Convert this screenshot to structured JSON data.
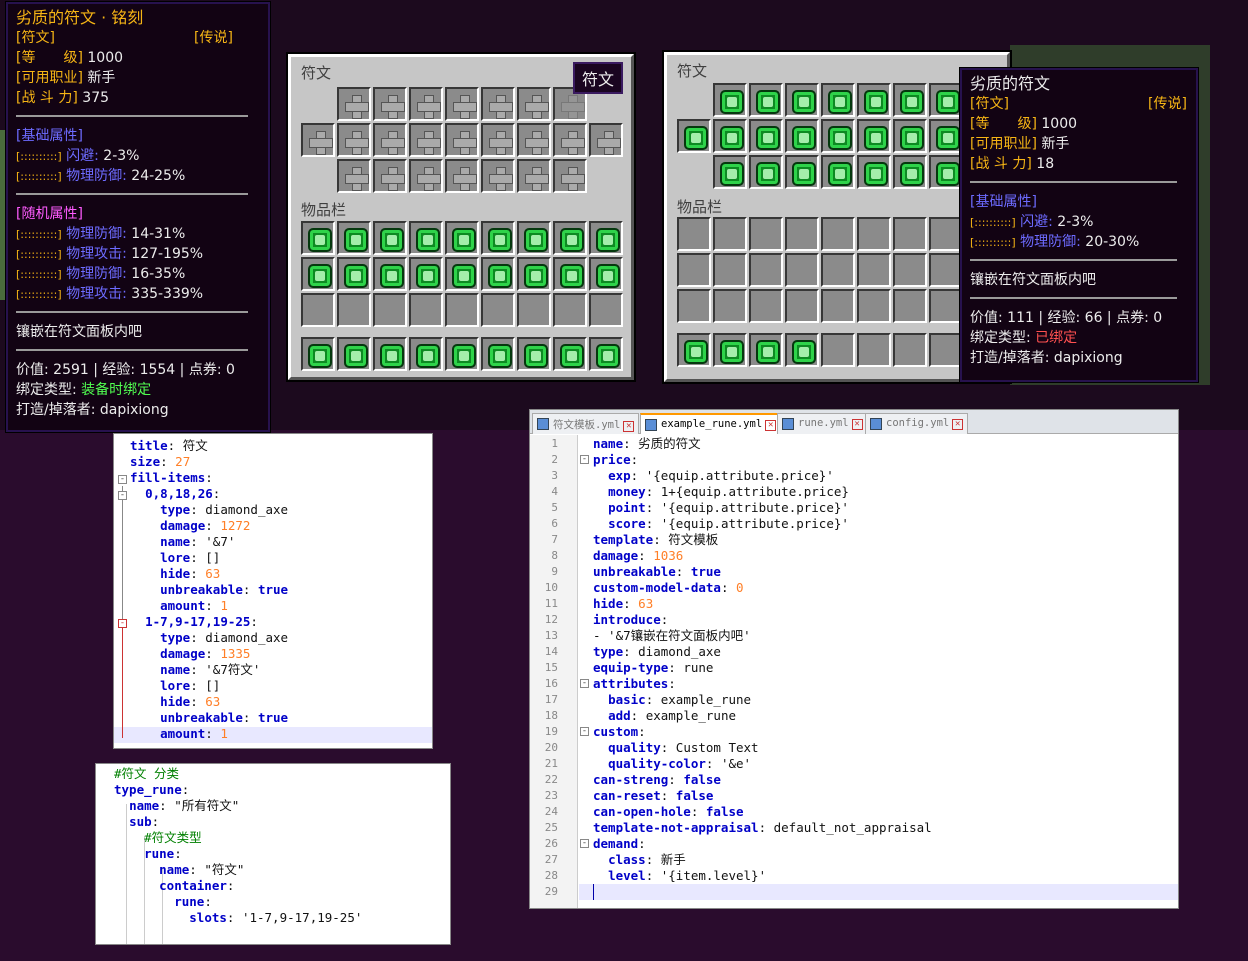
{
  "tooltip_left": {
    "title": "劣质的符文 · 铭刻",
    "type_tag": "[符文]",
    "rarity_tag": "[传说]",
    "level_label": "[等　　级]",
    "level_val": "1000",
    "job_label": "[可用职业]",
    "job_val": "新手",
    "power_label": "[战 斗 力]",
    "power_val": "375",
    "basic_header": "[基础属性]",
    "basic": [
      {
        "bar": "[::::::::::]",
        "name": "闪避:",
        "val": "2-3%"
      },
      {
        "bar": "[::::::::::]",
        "name": "物理防御:",
        "val": "24-25%"
      }
    ],
    "random_header": "[随机属性]",
    "random": [
      {
        "bar": "[::::::::::]",
        "name": "物理防御:",
        "val": "14-31%"
      },
      {
        "bar": "[::::::::::]",
        "name": "物理攻击:",
        "val": "127-195%"
      },
      {
        "bar": "[::::::::::]",
        "name": "物理防御:",
        "val": "16-35%"
      },
      {
        "bar": "[::::::::::]",
        "name": "物理攻击:",
        "val": "335-339%"
      }
    ],
    "intro": "镶嵌在符文面板内吧",
    "value_line": "价值: 2591 | 经验: 1554 | 点券: 0",
    "bind_label": "绑定类型:",
    "bind_val": "装备时绑定",
    "maker": "打造/掉落者: dapixiong"
  },
  "gui_left": {
    "title": "符文",
    "inventory": "物品栏",
    "tab": "符文"
  },
  "gui_right": {
    "title": "符文",
    "inventory": "物品栏"
  },
  "tooltip_right": {
    "title": "劣质的符文",
    "type_tag": "[符文]",
    "rarity_tag": "[传说]",
    "level_label": "[等　　级]",
    "level_val": "1000",
    "job_label": "[可用职业]",
    "job_val": "新手",
    "power_label": "[战 斗 力]",
    "power_val": "18",
    "basic_header": "[基础属性]",
    "basic": [
      {
        "bar": "[::::::::::]",
        "name": "闪避:",
        "val": "2-3%"
      },
      {
        "bar": "[::::::::::]",
        "name": "物理防御:",
        "val": "20-30%"
      }
    ],
    "intro": "镶嵌在符文面板内吧",
    "value_line": "价值: 111 | 经验: 66 | 点券: 0",
    "bind_label": "绑定类型:",
    "bind_val": "已绑定",
    "maker": "打造/掉落者: dapixiong"
  },
  "yaml1": [
    {
      "t": [
        [
          "k",
          "title"
        ],
        [
          "s",
          ": 符文"
        ]
      ]
    },
    {
      "t": [
        [
          "k",
          "size"
        ],
        [
          "s",
          ": "
        ],
        [
          "n",
          "27"
        ]
      ]
    },
    {
      "t": [
        [
          "k",
          "fill-items"
        ],
        [
          "s",
          ":"
        ]
      ]
    },
    {
      "t": [
        [
          "s",
          "  "
        ],
        [
          "k",
          "0,8,18,26"
        ],
        [
          "s",
          ":"
        ]
      ]
    },
    {
      "t": [
        [
          "s",
          "    "
        ],
        [
          "k",
          "type"
        ],
        [
          "s",
          ": diamond_axe"
        ]
      ]
    },
    {
      "t": [
        [
          "s",
          "    "
        ],
        [
          "k",
          "damage"
        ],
        [
          "s",
          ": "
        ],
        [
          "n",
          "1272"
        ]
      ]
    },
    {
      "t": [
        [
          "s",
          "    "
        ],
        [
          "k",
          "name"
        ],
        [
          "s",
          ": '&7'"
        ]
      ]
    },
    {
      "t": [
        [
          "s",
          "    "
        ],
        [
          "k",
          "lore"
        ],
        [
          "s",
          ": []"
        ]
      ]
    },
    {
      "t": [
        [
          "s",
          "    "
        ],
        [
          "k",
          "hide"
        ],
        [
          "s",
          ": "
        ],
        [
          "n",
          "63"
        ]
      ]
    },
    {
      "t": [
        [
          "s",
          "    "
        ],
        [
          "k",
          "unbreakable"
        ],
        [
          "s",
          ": "
        ],
        [
          "k",
          "true"
        ]
      ]
    },
    {
      "t": [
        [
          "s",
          "    "
        ],
        [
          "k",
          "amount"
        ],
        [
          "s",
          ": "
        ],
        [
          "n",
          "1"
        ]
      ]
    },
    {
      "t": [
        [
          "s",
          "  "
        ],
        [
          "k",
          "1-7,9-17,19-25"
        ],
        [
          "s",
          ":"
        ]
      ]
    },
    {
      "t": [
        [
          "s",
          "    "
        ],
        [
          "k",
          "type"
        ],
        [
          "s",
          ": diamond_axe"
        ]
      ]
    },
    {
      "t": [
        [
          "s",
          "    "
        ],
        [
          "k",
          "damage"
        ],
        [
          "s",
          ": "
        ],
        [
          "n",
          "1335"
        ]
      ]
    },
    {
      "t": [
        [
          "s",
          "    "
        ],
        [
          "k",
          "name"
        ],
        [
          "s",
          ": '&7符文'"
        ]
      ]
    },
    {
      "t": [
        [
          "s",
          "    "
        ],
        [
          "k",
          "lore"
        ],
        [
          "s",
          ": []"
        ]
      ]
    },
    {
      "t": [
        [
          "s",
          "    "
        ],
        [
          "k",
          "hide"
        ],
        [
          "s",
          ": "
        ],
        [
          "n",
          "63"
        ]
      ]
    },
    {
      "t": [
        [
          "s",
          "    "
        ],
        [
          "k",
          "unbreakable"
        ],
        [
          "s",
          ": "
        ],
        [
          "k",
          "true"
        ]
      ]
    },
    {
      "t": [
        [
          "s",
          "    "
        ],
        [
          "k",
          "amount"
        ],
        [
          "s",
          ": "
        ],
        [
          "n",
          "1"
        ]
      ]
    }
  ],
  "yaml2": [
    {
      "t": [
        [
          "c",
          "#符文 分类"
        ]
      ]
    },
    {
      "t": [
        [
          "k",
          "type_rune"
        ],
        [
          "s",
          ":"
        ]
      ]
    },
    {
      "t": [
        [
          "s",
          "  "
        ],
        [
          "k",
          "name"
        ],
        [
          "s",
          ": \"所有符文\""
        ]
      ]
    },
    {
      "t": [
        [
          "s",
          "  "
        ],
        [
          "k",
          "sub"
        ],
        [
          "s",
          ":"
        ]
      ]
    },
    {
      "t": [
        [
          "s",
          "    "
        ],
        [
          "c",
          "#符文类型"
        ]
      ]
    },
    {
      "t": [
        [
          "s",
          "    "
        ],
        [
          "k",
          "rune"
        ],
        [
          "s",
          ":"
        ]
      ]
    },
    {
      "t": [
        [
          "s",
          "      "
        ],
        [
          "k",
          "name"
        ],
        [
          "s",
          ": \"符文\""
        ]
      ]
    },
    {
      "t": [
        [
          "s",
          "      "
        ],
        [
          "k",
          "container"
        ],
        [
          "s",
          ":"
        ]
      ]
    },
    {
      "t": [
        [
          "s",
          "        "
        ],
        [
          "k",
          "rune"
        ],
        [
          "s",
          ":"
        ]
      ]
    },
    {
      "t": [
        [
          "s",
          "          "
        ],
        [
          "k",
          "slots"
        ],
        [
          "s",
          ": '1-7,9-17,19-25'"
        ]
      ]
    }
  ],
  "editor3": {
    "tabs": [
      "符文模板.yml",
      "example_rune.yml",
      "rune.yml",
      "config.yml"
    ],
    "active_tab": 1,
    "lines": [
      {
        "t": [
          [
            "k",
            "name"
          ],
          [
            "s",
            ": 劣质的符文"
          ]
        ]
      },
      {
        "t": [
          [
            "k",
            "price"
          ],
          [
            "s",
            ":"
          ]
        ]
      },
      {
        "t": [
          [
            "s",
            "  "
          ],
          [
            "k",
            "exp"
          ],
          [
            "s",
            ": '{equip.attribute.price}'"
          ]
        ]
      },
      {
        "t": [
          [
            "s",
            "  "
          ],
          [
            "k",
            "money"
          ],
          [
            "s",
            ": 1+{equip.attribute.price}"
          ]
        ]
      },
      {
        "t": [
          [
            "s",
            "  "
          ],
          [
            "k",
            "point"
          ],
          [
            "s",
            ": '{equip.attribute.price}'"
          ]
        ]
      },
      {
        "t": [
          [
            "s",
            "  "
          ],
          [
            "k",
            "score"
          ],
          [
            "s",
            ": '{equip.attribute.price}'"
          ]
        ]
      },
      {
        "t": [
          [
            "k",
            "template"
          ],
          [
            "s",
            ": 符文模板"
          ]
        ]
      },
      {
        "t": [
          [
            "k",
            "damage"
          ],
          [
            "s",
            ": "
          ],
          [
            "n",
            "1036"
          ]
        ]
      },
      {
        "t": [
          [
            "k",
            "unbreakable"
          ],
          [
            "s",
            ": "
          ],
          [
            "k",
            "true"
          ]
        ]
      },
      {
        "t": [
          [
            "k",
            "custom-model-data"
          ],
          [
            "s",
            ": "
          ],
          [
            "n",
            "0"
          ]
        ]
      },
      {
        "t": [
          [
            "k",
            "hide"
          ],
          [
            "s",
            ": "
          ],
          [
            "n",
            "63"
          ]
        ]
      },
      {
        "t": [
          [
            "k",
            "introduce"
          ],
          [
            "s",
            ":"
          ]
        ]
      },
      {
        "t": [
          [
            "s",
            "- '&7镶嵌在符文面板内吧'"
          ]
        ]
      },
      {
        "t": [
          [
            "k",
            "type"
          ],
          [
            "s",
            ": diamond_axe"
          ]
        ]
      },
      {
        "t": [
          [
            "k",
            "equip-type"
          ],
          [
            "s",
            ": rune"
          ]
        ]
      },
      {
        "t": [
          [
            "k",
            "attributes"
          ],
          [
            "s",
            ":"
          ]
        ]
      },
      {
        "t": [
          [
            "s",
            "  "
          ],
          [
            "k",
            "basic"
          ],
          [
            "s",
            ": example_rune"
          ]
        ]
      },
      {
        "t": [
          [
            "s",
            "  "
          ],
          [
            "k",
            "add"
          ],
          [
            "s",
            ": example_rune"
          ]
        ]
      },
      {
        "t": [
          [
            "k",
            "custom"
          ],
          [
            "s",
            ":"
          ]
        ]
      },
      {
        "t": [
          [
            "s",
            "  "
          ],
          [
            "k",
            "quality"
          ],
          [
            "s",
            ": Custom Text"
          ]
        ]
      },
      {
        "t": [
          [
            "s",
            "  "
          ],
          [
            "k",
            "quality-color"
          ],
          [
            "s",
            ": '&e'"
          ]
        ]
      },
      {
        "t": [
          [
            "k",
            "can-streng"
          ],
          [
            "s",
            ": "
          ],
          [
            "k",
            "false"
          ]
        ]
      },
      {
        "t": [
          [
            "k",
            "can-reset"
          ],
          [
            "s",
            ": "
          ],
          [
            "k",
            "false"
          ]
        ]
      },
      {
        "t": [
          [
            "k",
            "can-open-hole"
          ],
          [
            "s",
            ": "
          ],
          [
            "k",
            "false"
          ]
        ]
      },
      {
        "t": [
          [
            "k",
            "template-not-appraisal"
          ],
          [
            "s",
            ": default_not_appraisal"
          ]
        ]
      },
      {
        "t": [
          [
            "k",
            "demand"
          ],
          [
            "s",
            ":"
          ]
        ]
      },
      {
        "t": [
          [
            "s",
            "  "
          ],
          [
            "k",
            "class"
          ],
          [
            "s",
            ": 新手"
          ]
        ]
      },
      {
        "t": [
          [
            "s",
            "  "
          ],
          [
            "k",
            "level"
          ],
          [
            "s",
            ": '{item.level}'"
          ]
        ]
      },
      {
        "t": [
          [
            "s",
            ""
          ]
        ]
      }
    ]
  }
}
